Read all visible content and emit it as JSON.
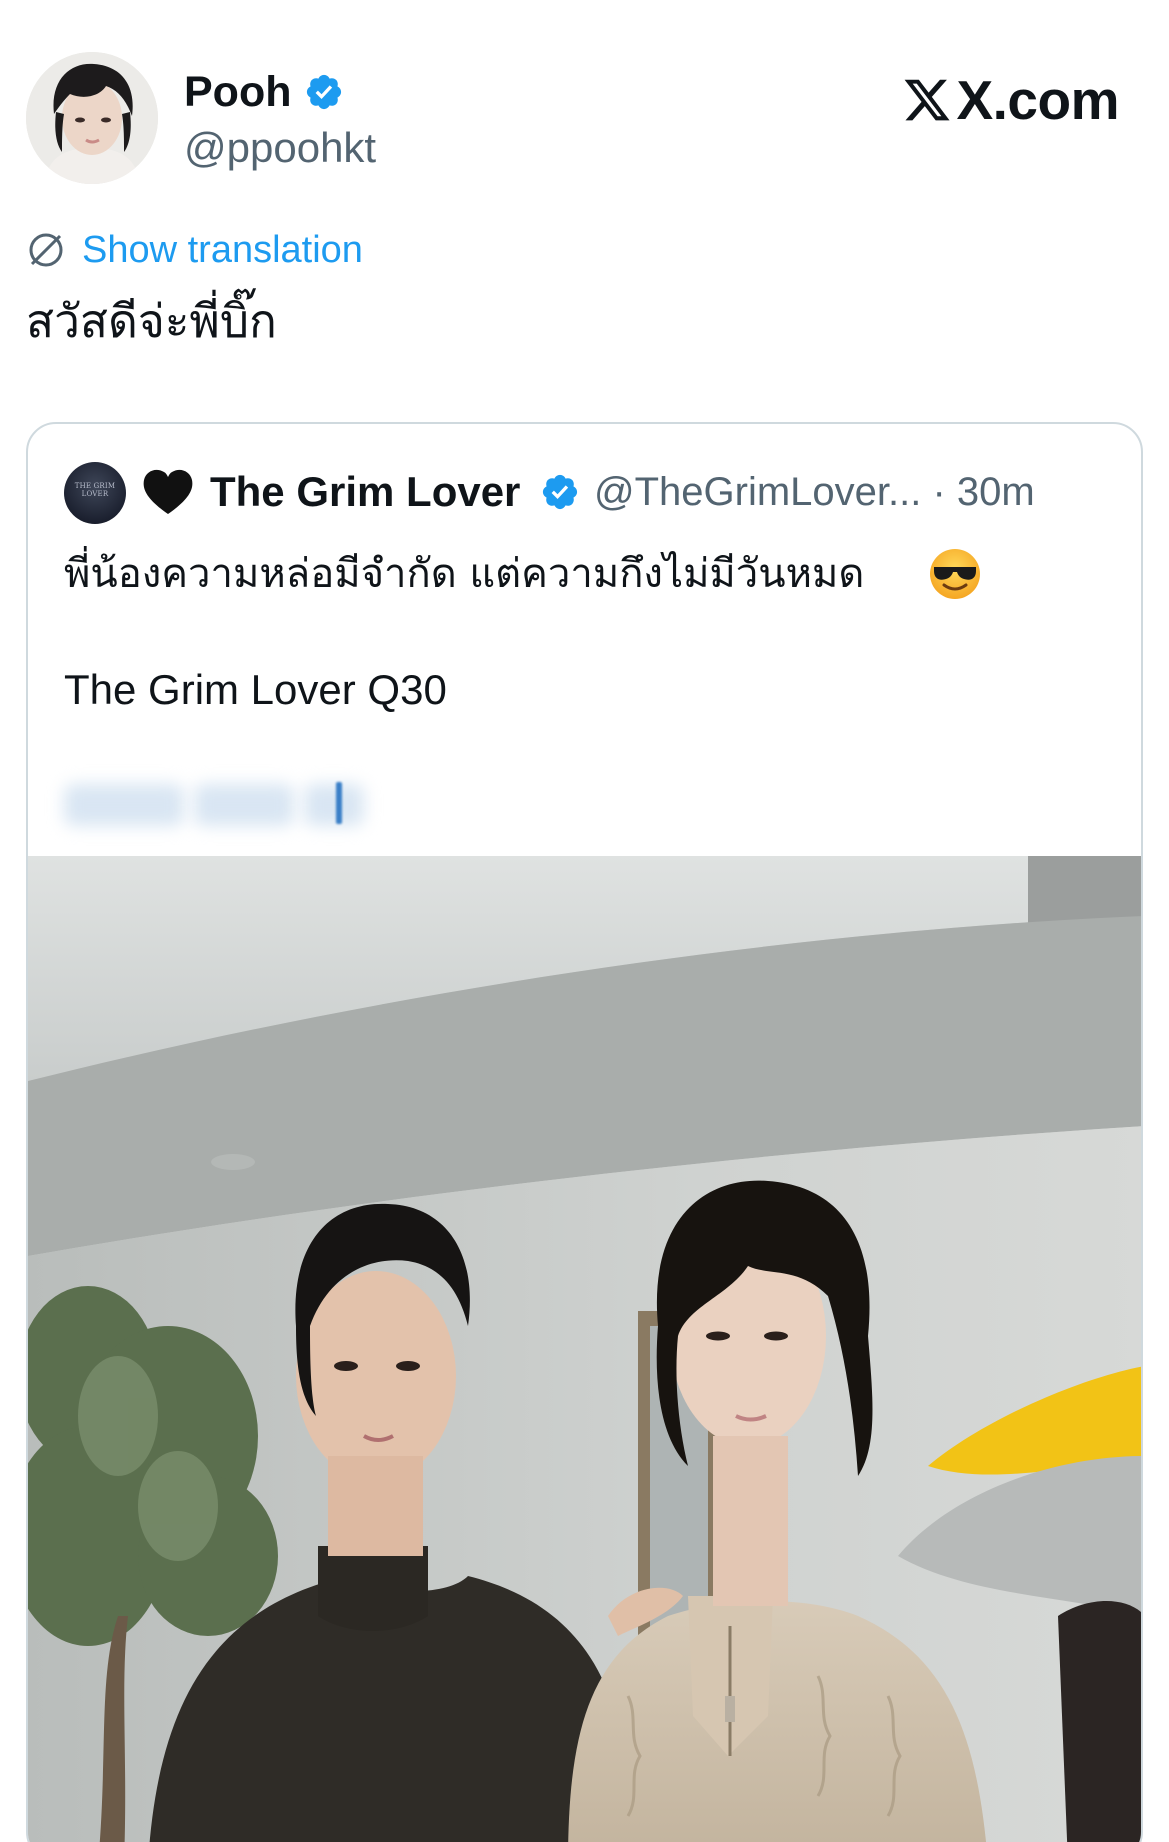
{
  "author": {
    "display_name": "Pooh",
    "handle": "@ppoohkt",
    "verified": true
  },
  "brand": {
    "label": "X.com"
  },
  "translation": {
    "link_label": "Show translation"
  },
  "tweet": {
    "text": "สวัสดีจ่ะพี่บิ๊ก"
  },
  "quoted_tweet": {
    "avatar_text": "THE GRIM LOVER",
    "emoji_prefix": "black-heart",
    "display_name": "The Grim Lover",
    "verified": true,
    "handle_time": "@TheGrimLover... · 30m",
    "text_line_1": "พี่น้องความหล่อมีจำกัด แต่ความกึงไม่มีวันหมด",
    "text_emoji": "smiling-face-with-sunglasses",
    "text_line_2": "The Grim Lover Q30"
  },
  "colors": {
    "accent_blue": "#1d9bf0",
    "secondary_text": "#536471",
    "primary_text": "#0f1419",
    "border": "#cfd9de"
  }
}
